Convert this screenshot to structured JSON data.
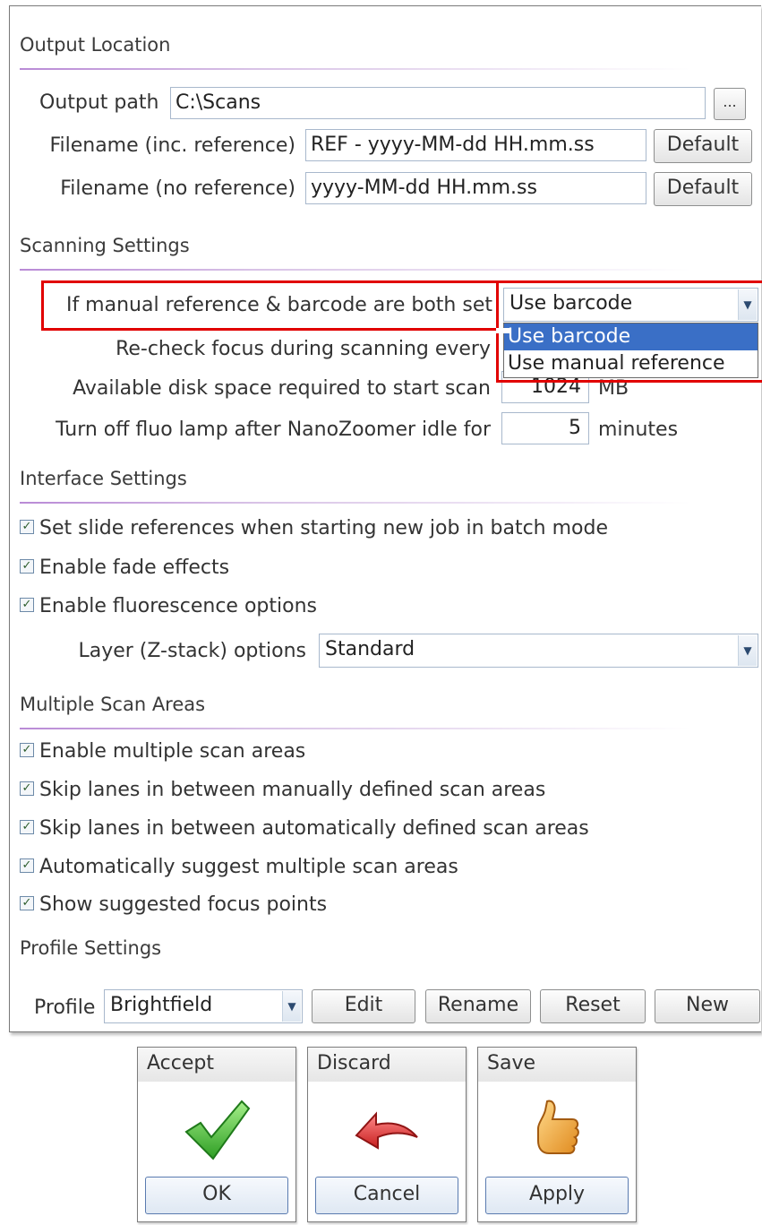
{
  "output_location": {
    "title": "Output Location",
    "output_path_label": "Output path",
    "output_path_value": "C:\\Scans",
    "browse_label": "...",
    "filename_ref_label": "Filename (inc. reference)",
    "filename_ref_value": "REF - yyyy-MM-dd HH.mm.ss",
    "filename_noref_label": "Filename (no reference)",
    "filename_noref_value": "yyyy-MM-dd HH.mm.ss",
    "default_label": "Default"
  },
  "scanning": {
    "title": "Scanning Settings",
    "manual_ref_label": "If manual reference & barcode are both set",
    "manual_ref_value": "Use barcode",
    "options": [
      "Use barcode",
      "Use manual reference"
    ],
    "recheck_label": "Re-check focus during scanning every",
    "disk_label": "Available disk space required to start scan",
    "disk_value": "1024",
    "disk_unit": "MB",
    "fluo_label": "Turn off fluo lamp after NanoZoomer idle for",
    "fluo_value": "5",
    "fluo_unit": "minutes"
  },
  "interface": {
    "title": "Interface Settings",
    "check_slide_refs": "Set slide references when starting new job in batch mode",
    "check_fade": "Enable fade effects",
    "check_fluo": "Enable fluorescence options",
    "layer_label": "Layer (Z-stack) options",
    "layer_value": "Standard"
  },
  "multi_scan": {
    "title": "Multiple Scan Areas",
    "check_enable": "Enable multiple scan areas",
    "check_skip_manual": "Skip lanes in between manually defined scan areas",
    "check_skip_auto": "Skip lanes in between automatically defined scan areas",
    "check_suggest": "Automatically suggest multiple scan areas",
    "check_focus_points": "Show suggested focus points"
  },
  "profile": {
    "title": "Profile Settings",
    "profile_label": "Profile",
    "profile_value": "Brightfield",
    "edit": "Edit",
    "rename": "Rename",
    "reset": "Reset",
    "new": "New"
  },
  "actions": {
    "accept_title": "Accept",
    "accept_button": "OK",
    "discard_title": "Discard",
    "discard_button": "Cancel",
    "save_title": "Save",
    "save_button": "Apply"
  },
  "colors": {
    "highlight": "#e10000",
    "selection": "#3a6fc6",
    "separator": "#b98ad6"
  }
}
